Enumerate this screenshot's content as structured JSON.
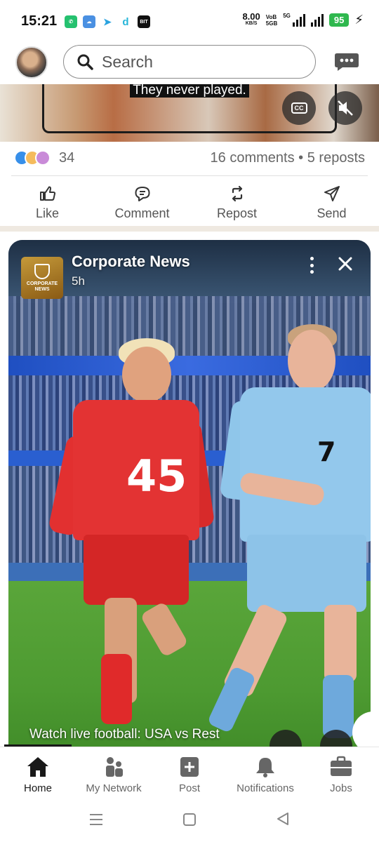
{
  "status_bar": {
    "time": "15:21",
    "app_icons": [
      "whatsapp-icon",
      "weather-icon",
      "telegram-icon",
      "d-app-icon",
      "bit-app-icon"
    ],
    "net_speed": "8.00",
    "net_unit": "KB/S",
    "volte_1": "Vo",
    "volte_2": "5G",
    "volte_3": "B",
    "volte_4": "B",
    "network": "5G",
    "battery": "95"
  },
  "header": {
    "search_placeholder": "Search"
  },
  "previous_post": {
    "caption": "They never played.",
    "cc_label": "CC",
    "reaction_count": "34",
    "comments": "16 comments",
    "separator": "•",
    "reposts": "5 reposts",
    "actions": [
      {
        "label": "Like",
        "icon": "like-icon"
      },
      {
        "label": "Comment",
        "icon": "comment-icon"
      },
      {
        "label": "Repost",
        "icon": "repost-icon"
      },
      {
        "label": "Send",
        "icon": "send-icon"
      }
    ]
  },
  "video_card": {
    "channel_name": "Corporate News",
    "posted": "5h",
    "logo_line1": "CORPORATE",
    "logo_line2": "NEWS",
    "caption": "Watch live football: USA vs Rest",
    "player_left_number": "45",
    "player_right_number": "7",
    "playback_progress": 0.2
  },
  "bottom_nav": [
    {
      "label": "Home",
      "icon": "home-icon",
      "active": true
    },
    {
      "label": "My Network",
      "icon": "network-icon",
      "active": false
    },
    {
      "label": "Post",
      "icon": "post-icon",
      "active": false
    },
    {
      "label": "Notifications",
      "icon": "bell-icon",
      "active": false
    },
    {
      "label": "Jobs",
      "icon": "briefcase-icon",
      "active": false
    }
  ],
  "colors": {
    "battery_green": "#2fb84e",
    "text_primary": "#191919",
    "text_secondary": "#666666",
    "feed_separator": "#efe9e1"
  }
}
